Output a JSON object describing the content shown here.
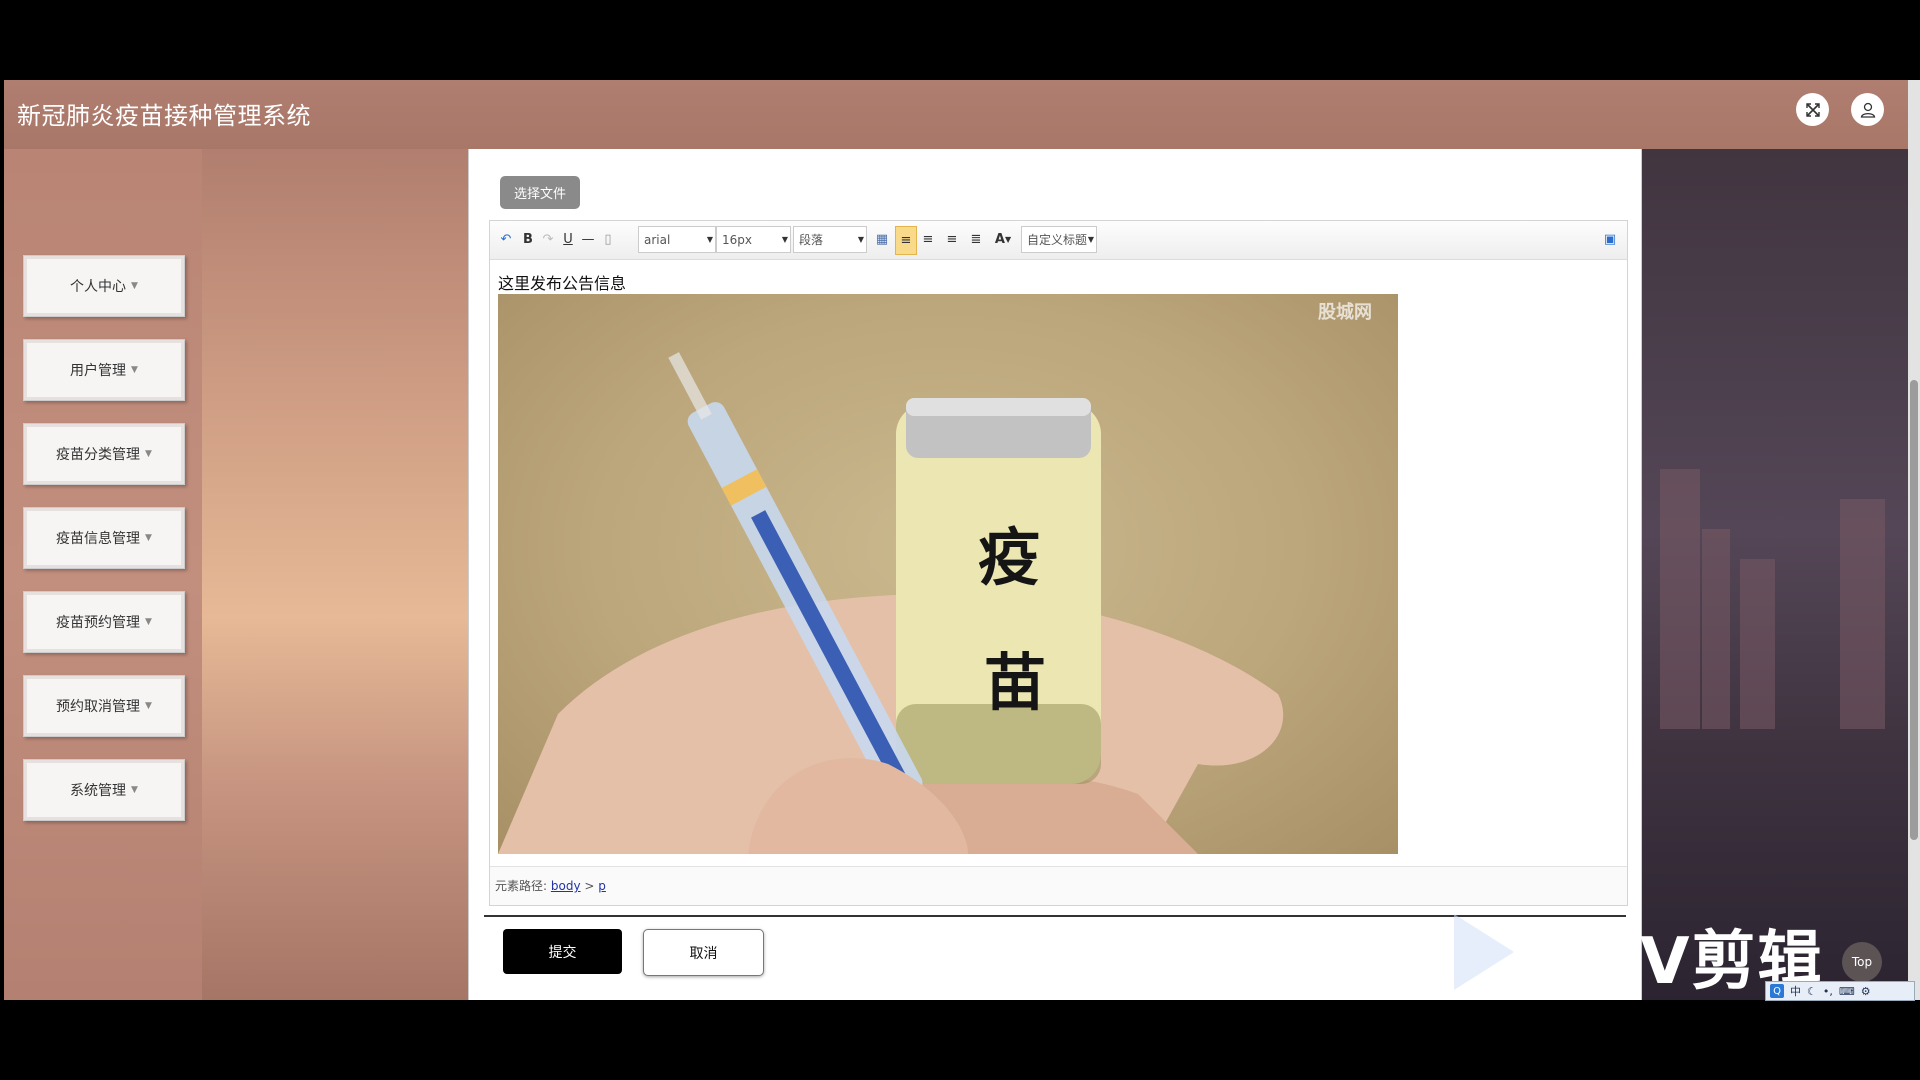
{
  "app": {
    "title": "新冠肺炎疫苗接种管理系统"
  },
  "header": {
    "fullscreen_icon": "fullscreen-exit-icon",
    "user_icon": "user-icon"
  },
  "sidebar": {
    "items": [
      {
        "label": "个人中心"
      },
      {
        "label": "用户管理"
      },
      {
        "label": "疫苗分类管理"
      },
      {
        "label": "疫苗信息管理"
      },
      {
        "label": "疫苗预约管理"
      },
      {
        "label": "预约取消管理"
      },
      {
        "label": "系统管理"
      }
    ]
  },
  "form": {
    "file_button": "选择文件",
    "toolbar": {
      "font_family": "arial",
      "font_size": "16px",
      "paragraph": "段落",
      "custom_title": "自定义标题",
      "font_color": "A",
      "bold": "B",
      "underline": "U"
    },
    "editor": {
      "text": "这里发布公告信息",
      "image_label_1": "疫",
      "image_label_2": "苗",
      "image_watermark": "股城网"
    },
    "element_path": {
      "label": "元素路径:",
      "body": "body",
      "sep": ">",
      "p": "p"
    },
    "submit": "提交",
    "cancel": "取消"
  },
  "overlay": {
    "top_button": "Top",
    "watermark": "V剪辑",
    "ime": "中"
  },
  "colors": {
    "header": "#a97768",
    "submit_bg": "#000000",
    "accent_link": "#2233aa"
  }
}
